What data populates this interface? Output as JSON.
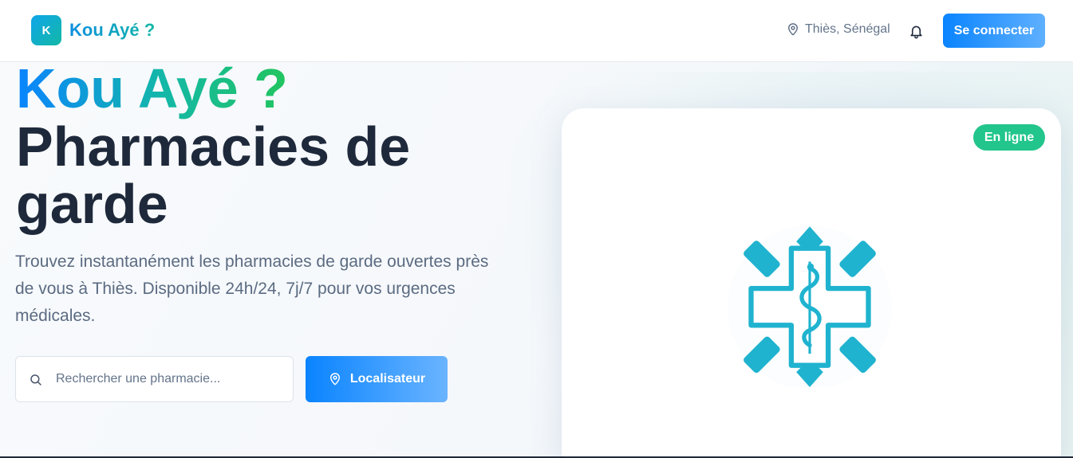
{
  "header": {
    "logo_letter": "K",
    "brand_name": "Kou Ayé ?",
    "location": "Thiès, Sénégal",
    "login_label": "Se connecter"
  },
  "hero": {
    "title_line1": "Kou Ayé ?",
    "title_line2": "Pharmacies de garde",
    "description": "Trouvez instantanément les pharmacies de garde ouvertes près de vous à Thiès. Disponible 24h/24, 7j/7 pour vos urgences médicales."
  },
  "search": {
    "placeholder": "Rechercher une pharmacie...",
    "locator_label": "Localisateur"
  },
  "card": {
    "status": "En ligne"
  },
  "colors": {
    "primary": "#0a84ff",
    "accent": "#14b8a6",
    "status_green": "#22c58b",
    "logo_teal": "#1fb3cf"
  },
  "icons": [
    "location-pin-icon",
    "bell-icon",
    "search-icon",
    "pharmacy-cross-icon"
  ]
}
